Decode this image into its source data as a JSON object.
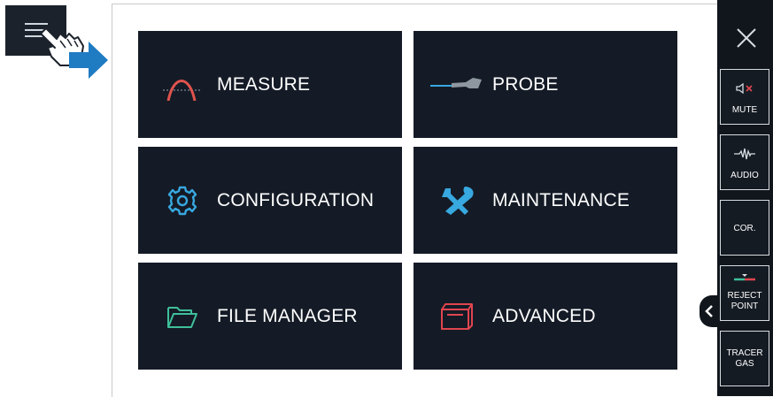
{
  "tiles": [
    {
      "label": "MEASURE",
      "icon": "measure-curve-icon"
    },
    {
      "label": "PROBE",
      "icon": "probe-icon"
    },
    {
      "label": "CONFIGURATION",
      "icon": "gear-icon"
    },
    {
      "label": "MAINTENANCE",
      "icon": "wrench-screwdriver-icon"
    },
    {
      "label": "FILE MANAGER",
      "icon": "folder-icon"
    },
    {
      "label": "ADVANCED",
      "icon": "box-icon"
    }
  ],
  "sidebar": {
    "close_icon": "close-icon",
    "buttons": [
      {
        "label": "MUTE",
        "icon": "speaker-mute-icon"
      },
      {
        "label": "AUDIO",
        "icon": "audio-wave-icon"
      },
      {
        "label": "COR.",
        "icon": ""
      },
      {
        "label_line1": "REJECT",
        "label_line2": "POINT",
        "icon": "reject-point-icon"
      },
      {
        "label_line1": "TRACER",
        "label_line2": "GAS",
        "icon": ""
      }
    ]
  },
  "colors": {
    "tile_bg": "#141b26",
    "sidebar_bg": "#11161d",
    "accent_blue": "#1f7bc2",
    "measure_red": "#e0534d",
    "config_blue": "#38a8e0",
    "folder_green": "#3fbf9a",
    "advanced_red": "#e0454f"
  }
}
